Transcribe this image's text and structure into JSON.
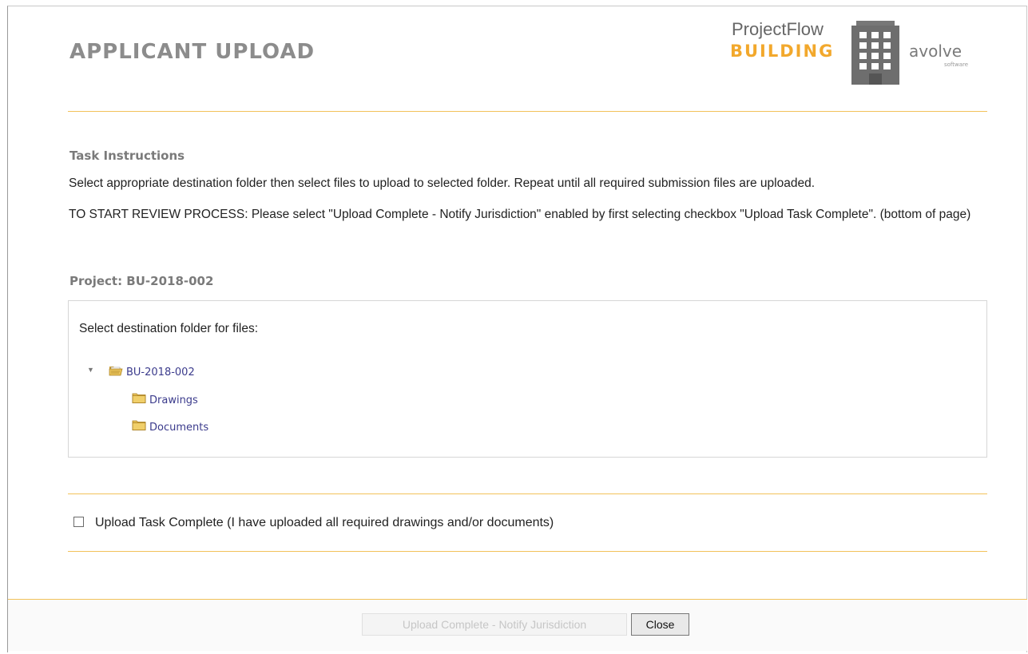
{
  "header": {
    "title": "APPLICANT UPLOAD",
    "logo": {
      "line1": "ProjectFlow",
      "line2": "BUILDING",
      "brand": "avolve",
      "brand_sub": "software",
      "icon": "building-icon"
    }
  },
  "instructions": {
    "heading": "Task Instructions",
    "line1": "Select appropriate destination folder then select files to upload to selected folder. Repeat until all required submission files are uploaded.",
    "line2": "TO START REVIEW PROCESS: Please select \"Upload Complete - Notify Jurisdiction\" enabled by first selecting checkbox \"Upload Task Complete\". (bottom of page)"
  },
  "project": {
    "heading": "Project: BU-2018-002",
    "panel_label": "Select destination folder for files:",
    "tree": {
      "root": {
        "label": "BU-2018-002",
        "icon": "open-folder-icon",
        "expanded": true
      },
      "children": [
        {
          "label": "Drawings",
          "icon": "folder-icon"
        },
        {
          "label": "Documents",
          "icon": "folder-icon"
        }
      ]
    }
  },
  "completion": {
    "checkbox_label": "Upload Task Complete (I have uploaded all required drawings and/or documents)",
    "checked": false
  },
  "footer": {
    "notify_button": "Upload Complete - Notify Jurisdiction",
    "notify_enabled": false,
    "close_button": "Close"
  },
  "colors": {
    "accent": "#f2a82c",
    "rule": "#f2c25a",
    "heading": "#8c8c8c",
    "link": "#3b3b8c"
  }
}
